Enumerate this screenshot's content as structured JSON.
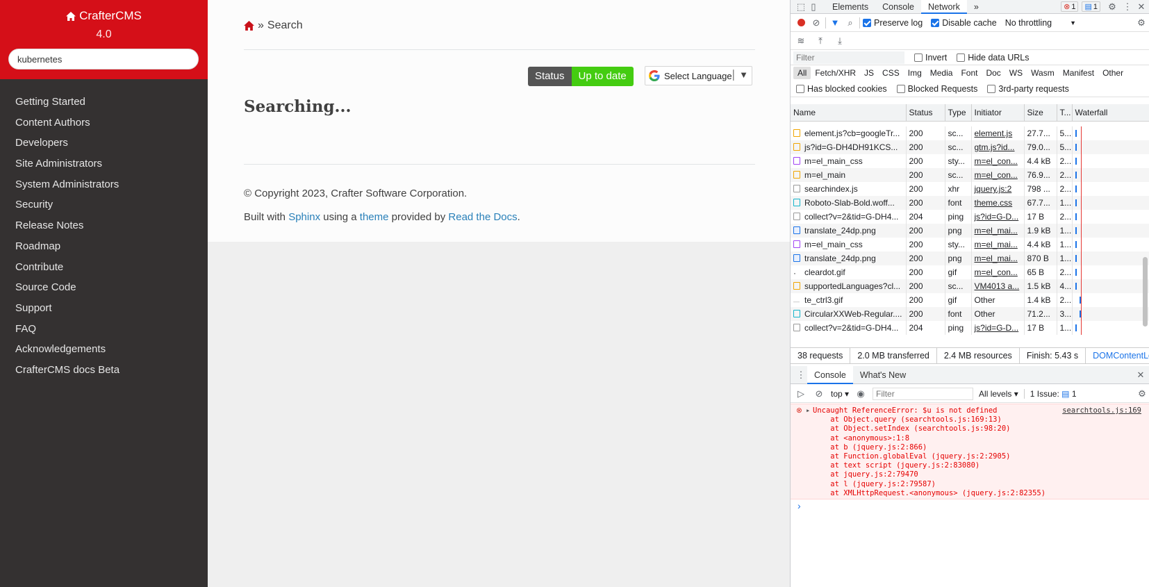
{
  "sidebar": {
    "brand": "CrafterCMS",
    "version": "4.0",
    "search_value": "kubernetes",
    "items": [
      "Getting Started",
      "Content Authors",
      "Developers",
      "Site Administrators",
      "System Administrators",
      "Security",
      "Release Notes",
      "Roadmap",
      "Contribute",
      "Source Code",
      "Support",
      "FAQ",
      "Acknowledgements",
      "CrafterCMS docs Beta"
    ]
  },
  "main": {
    "breadcrumb_sep": "»",
    "breadcrumb_current": "Search",
    "status_label": "Status",
    "status_value": "Up to date",
    "language_select": "Select Language",
    "heading": "Searching...",
    "copyright": "© Copyright 2023, Crafter Software Corporation.",
    "built_with": "Built with",
    "sphinx": "Sphinx",
    "using_a": "using a",
    "theme": "theme",
    "provided_by": "provided by",
    "read_the_docs": "Read the Docs",
    "period": "."
  },
  "devtools": {
    "tabs": [
      "Elements",
      "Console",
      "Network"
    ],
    "more": "»",
    "error_count": "1",
    "issue_count": "1",
    "preserve_log": "Preserve log",
    "disable_cache": "Disable cache",
    "throttling": "No throttling",
    "filter_placeholder": "Filter",
    "invert": "Invert",
    "hide_data_urls": "Hide data URLs",
    "types": [
      "All",
      "Fetch/XHR",
      "JS",
      "CSS",
      "Img",
      "Media",
      "Font",
      "Doc",
      "WS",
      "Wasm",
      "Manifest",
      "Other"
    ],
    "has_blocked_cookies": "Has blocked cookies",
    "blocked_requests": "Blocked Requests",
    "third_party": "3rd-party requests",
    "columns": [
      "Name",
      "Status",
      "Type",
      "Initiator",
      "Size",
      "T...",
      "Waterfall"
    ],
    "rows": [
      {
        "name": "element.js?cb=googleTr...",
        "status": "200",
        "type": "sc...",
        "initiator": "element.js",
        "size": "27.7...",
        "time": "5...",
        "icon": "js"
      },
      {
        "name": "js?id=G-DH4DH91KCS...",
        "status": "200",
        "type": "sc...",
        "initiator": "gtm.js?id...",
        "size": "79.0...",
        "time": "5...",
        "icon": "js"
      },
      {
        "name": "m=el_main_css",
        "status": "200",
        "type": "sty...",
        "initiator": "m=el_con...",
        "size": "4.4 kB",
        "time": "2...",
        "icon": "css"
      },
      {
        "name": "m=el_main",
        "status": "200",
        "type": "sc...",
        "initiator": "m=el_con...",
        "size": "76.9...",
        "time": "2...",
        "icon": "js"
      },
      {
        "name": "searchindex.js",
        "status": "200",
        "type": "xhr",
        "initiator": "jquery.js:2",
        "size": "798 ...",
        "time": "2...",
        "icon": "doc"
      },
      {
        "name": "Roboto-Slab-Bold.woff...",
        "status": "200",
        "type": "font",
        "initiator": "theme.css",
        "size": "67.7...",
        "time": "1...",
        "icon": "font"
      },
      {
        "name": "collect?v=2&tid=G-DH4...",
        "status": "204",
        "type": "ping",
        "initiator": "js?id=G-D...",
        "size": "17 B",
        "time": "2...",
        "icon": "doc"
      },
      {
        "name": "translate_24dp.png",
        "status": "200",
        "type": "png",
        "initiator": "m=el_mai...",
        "size": "1.9 kB",
        "time": "1...",
        "icon": "img"
      },
      {
        "name": "m=el_main_css",
        "status": "200",
        "type": "sty...",
        "initiator": "m=el_mai...",
        "size": "4.4 kB",
        "time": "1...",
        "icon": "css"
      },
      {
        "name": "translate_24dp.png",
        "status": "200",
        "type": "png",
        "initiator": "m=el_mai...",
        "size": "870 B",
        "time": "1...",
        "icon": "img"
      },
      {
        "name": "cleardot.gif",
        "status": "200",
        "type": "gif",
        "initiator": "m=el_con...",
        "size": "65 B",
        "time": "2...",
        "icon": "dot"
      },
      {
        "name": "supportedLanguages?cl...",
        "status": "200",
        "type": "sc...",
        "initiator": "VM4013 a...",
        "size": "1.5 kB",
        "time": "4...",
        "icon": "js"
      },
      {
        "name": "te_ctrl3.gif",
        "status": "200",
        "type": "gif",
        "initiator": "Other",
        "size": "1.4 kB",
        "time": "2...",
        "icon": "line"
      },
      {
        "name": "CircularXXWeb-Regular....",
        "status": "200",
        "type": "font",
        "initiator": "Other",
        "size": "71.2...",
        "time": "3...",
        "icon": "font"
      },
      {
        "name": "collect?v=2&tid=G-DH4...",
        "status": "204",
        "type": "ping",
        "initiator": "js?id=G-D...",
        "size": "17 B",
        "time": "1...",
        "icon": "doc"
      }
    ],
    "summary": [
      "38 requests",
      "2.0 MB transferred",
      "2.4 MB resources",
      "Finish: 5.43 s",
      "DOMContentLoad"
    ],
    "drawer_tabs": [
      "Console",
      "What's New"
    ],
    "context": "top",
    "levels": "All levels",
    "issues": "1 Issue:",
    "issues_count": "1",
    "error_lines": [
      "Uncaught ReferenceError: $u is not defined",
      "    at Object.query (searchtools.js:169:13)",
      "    at Object.setIndex (searchtools.js:98:20)",
      "    at <anonymous>:1:8",
      "    at b (jquery.js:2:866)",
      "    at Function.globalEval (jquery.js:2:2905)",
      "    at text script (jquery.js:2:83080)",
      "    at jquery.js:2:79470",
      "    at l (jquery.js:2:79587)",
      "    at XMLHttpRequest.<anonymous> (jquery.js:2:82355)"
    ],
    "error_source": "searchtools.js:169",
    "prompt": "›"
  }
}
